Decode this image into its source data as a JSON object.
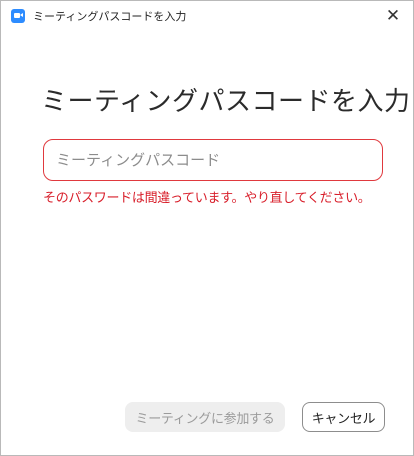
{
  "window": {
    "title": "ミーティングパスコードを入力",
    "close_glyph": "✕"
  },
  "dialog": {
    "heading": "ミーティングパスコードを入力",
    "passcode_placeholder": "ミーティングパスコード",
    "passcode_value": "",
    "error_message": "そのパスワードは間違っています。やり直してください。",
    "join_button_label": "ミーティングに参加する",
    "join_button_enabled": false,
    "cancel_button_label": "キャンセル"
  },
  "colors": {
    "error": "#d81e2a",
    "input_border_error": "#e0393e",
    "app_icon": "#2d8cff"
  },
  "icons": {
    "app": "zoom-app-icon",
    "close": "close-icon"
  }
}
